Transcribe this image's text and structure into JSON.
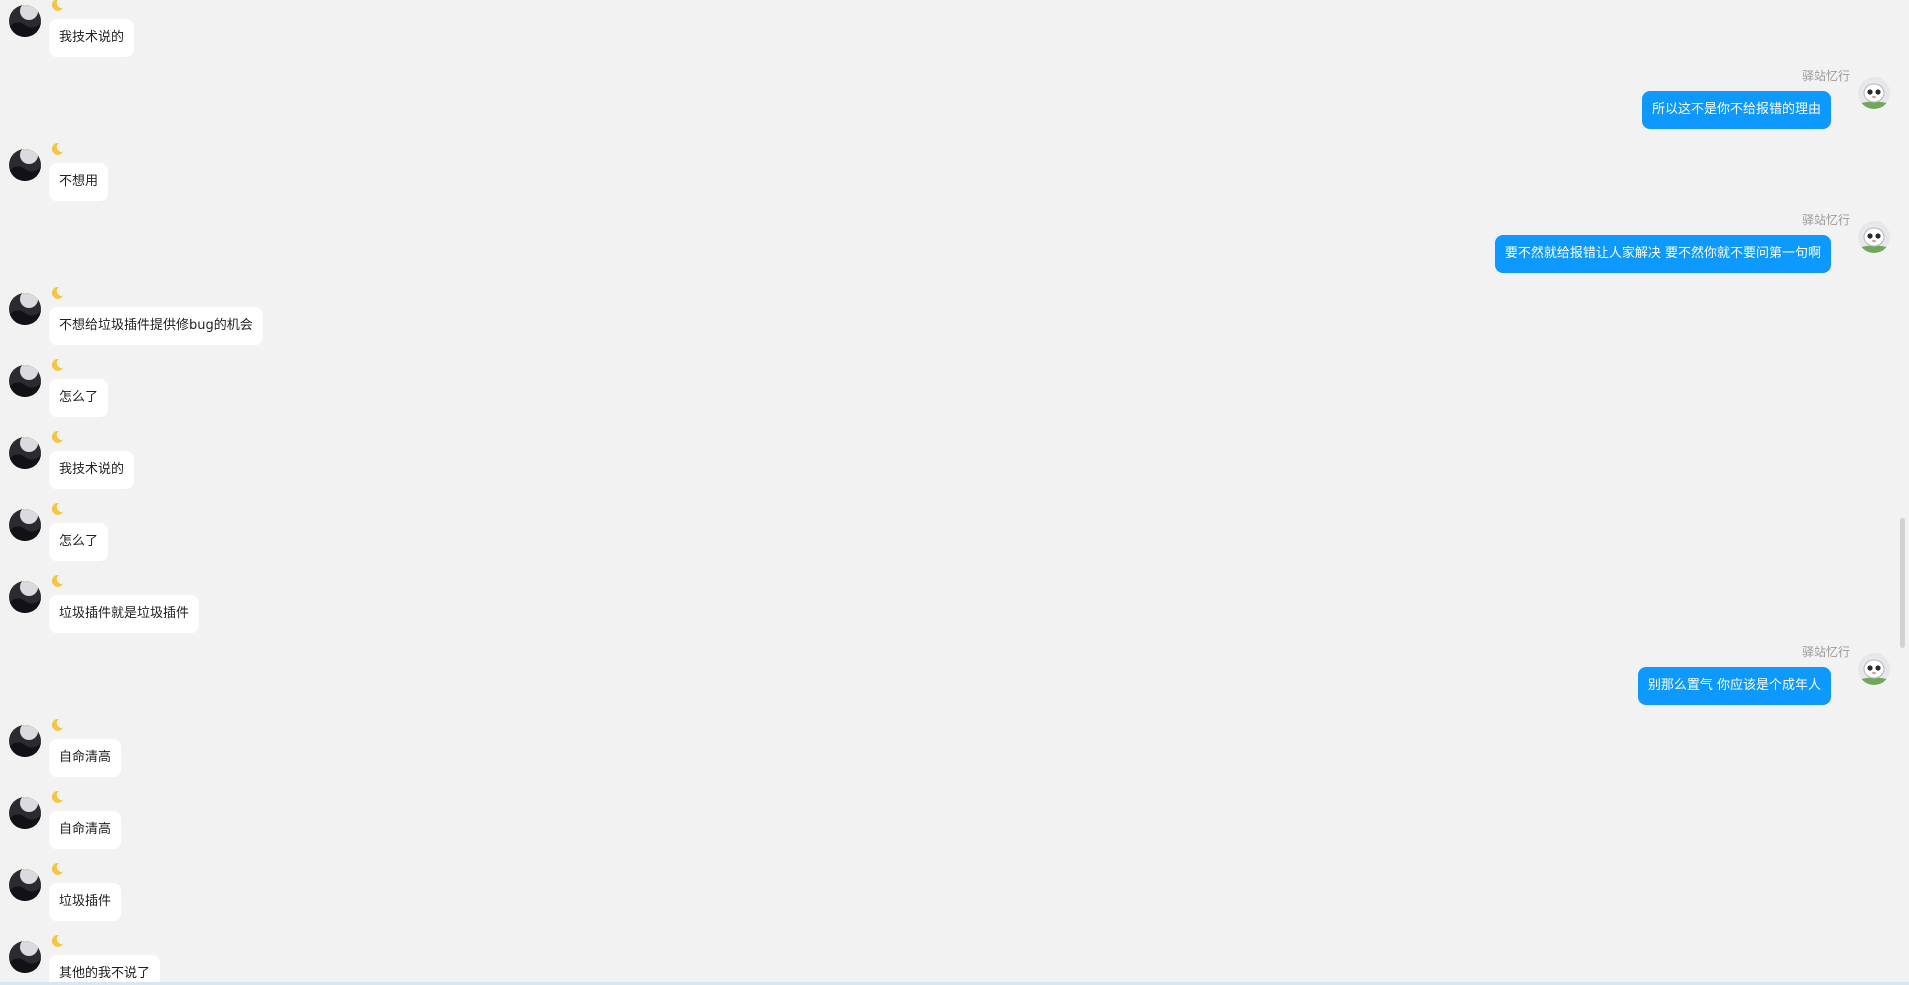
{
  "conversation": {
    "self_nickname": "驿站忆行",
    "other_nickname_icon": "crescent-moon-icon",
    "messages": [
      {
        "side": "left",
        "text": "我技术说的"
      },
      {
        "side": "right",
        "nickname": "驿站忆行",
        "text": "所以这不是你不给报错的理由"
      },
      {
        "side": "left",
        "text": "不想用"
      },
      {
        "side": "right",
        "nickname": "驿站忆行",
        "text": "要不然就给报错让人家解决 要不然你就不要问第一句啊"
      },
      {
        "side": "left",
        "text": "不想给垃圾插件提供修bug的机会"
      },
      {
        "side": "left",
        "text": "怎么了"
      },
      {
        "side": "left",
        "text": "我技术说的"
      },
      {
        "side": "left",
        "text": "怎么了"
      },
      {
        "side": "left",
        "text": "垃圾插件就是垃圾插件"
      },
      {
        "side": "right",
        "nickname": "驿站忆行",
        "text": "别那么置气 你应该是个成年人"
      },
      {
        "side": "left",
        "text": "自命清高"
      },
      {
        "side": "left",
        "text": "自命清高"
      },
      {
        "side": "left",
        "text": "垃圾插件"
      },
      {
        "side": "left",
        "text": "其他的我不说了"
      }
    ]
  },
  "colors": {
    "background": "#f2f2f2",
    "self_bubble": "#0d99ff",
    "other_bubble": "#ffffff",
    "nickname": "#9a9a9a"
  }
}
